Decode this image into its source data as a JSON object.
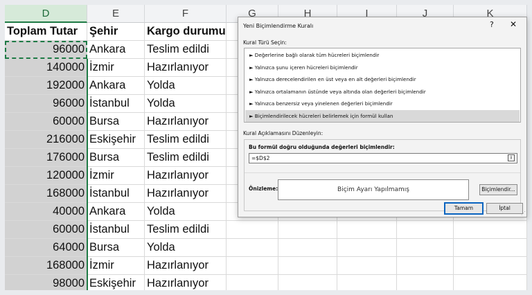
{
  "columns": [
    {
      "letter": "D",
      "selected": true
    },
    {
      "letter": "E",
      "selected": false
    },
    {
      "letter": "F",
      "selected": false
    },
    {
      "letter": "G",
      "selected": false
    },
    {
      "letter": "H",
      "selected": false
    },
    {
      "letter": "I",
      "selected": false
    },
    {
      "letter": "J",
      "selected": false
    },
    {
      "letter": "K",
      "selected": false
    }
  ],
  "headers": [
    "Toplam Tutar",
    "Şehir",
    "Kargo durumu"
  ],
  "rows": [
    {
      "total": "96000",
      "city": "Ankara",
      "status": "Teslim edildi"
    },
    {
      "total": "140000",
      "city": "İzmir",
      "status": "Hazırlanıyor"
    },
    {
      "total": "192000",
      "city": "Ankara",
      "status": "Yolda"
    },
    {
      "total": "96000",
      "city": "İstanbul",
      "status": "Yolda"
    },
    {
      "total": "60000",
      "city": "Bursa",
      "status": "Hazırlanıyor"
    },
    {
      "total": "216000",
      "city": "Eskişehir",
      "status": "Teslim edildi"
    },
    {
      "total": "176000",
      "city": "Bursa",
      "status": "Teslim edildi"
    },
    {
      "total": "120000",
      "city": "İzmir",
      "status": "Hazırlanıyor"
    },
    {
      "total": "168000",
      "city": "İstanbul",
      "status": "Hazırlanıyor"
    },
    {
      "total": "40000",
      "city": "Ankara",
      "status": "Yolda"
    },
    {
      "total": "60000",
      "city": "İstanbul",
      "status": "Teslim edildi"
    },
    {
      "total": "64000",
      "city": "Bursa",
      "status": "Yolda"
    },
    {
      "total": "168000",
      "city": "İzmir",
      "status": "Hazırlanıyor"
    },
    {
      "total": "98000",
      "city": "Eskişehir",
      "status": "Hazırlanıyor"
    }
  ],
  "dialog": {
    "title": "Yeni Biçimlendirme Kuralı",
    "help": "?",
    "close": "✕",
    "rule_type_label": "Kural Türü Seçin:",
    "rule_types": [
      "► Değerlerine bağlı olarak tüm hücreleri biçimlendir",
      "► Yalnızca şunu içeren hücreleri biçimlendir",
      "► Yalnızca derecelendirilen en üst veya en alt değerleri biçimlendir",
      "► Yalnızca ortalamanın üstünde veya altında olan değerleri biçimlendir",
      "► Yalnızca benzersiz veya yinelenen değerleri biçimlendir",
      "► Biçimlendirilecek hücreleri belirlemek için formül kullan"
    ],
    "selected_rule_index": 5,
    "edit_label": "Kural Açıklamasını Düzenleyin:",
    "formula_label": "Bu formül doğru olduğunda değerleri biçimlendir:",
    "formula_value": "=$D$2",
    "collapse_glyph": "⭱",
    "preview_label": "Önizleme:",
    "preview_text": "Biçim Ayarı Yapılmamış",
    "format_button": "Biçimlendir...",
    "ok_button": "Tamam",
    "cancel_button": "İptal"
  }
}
